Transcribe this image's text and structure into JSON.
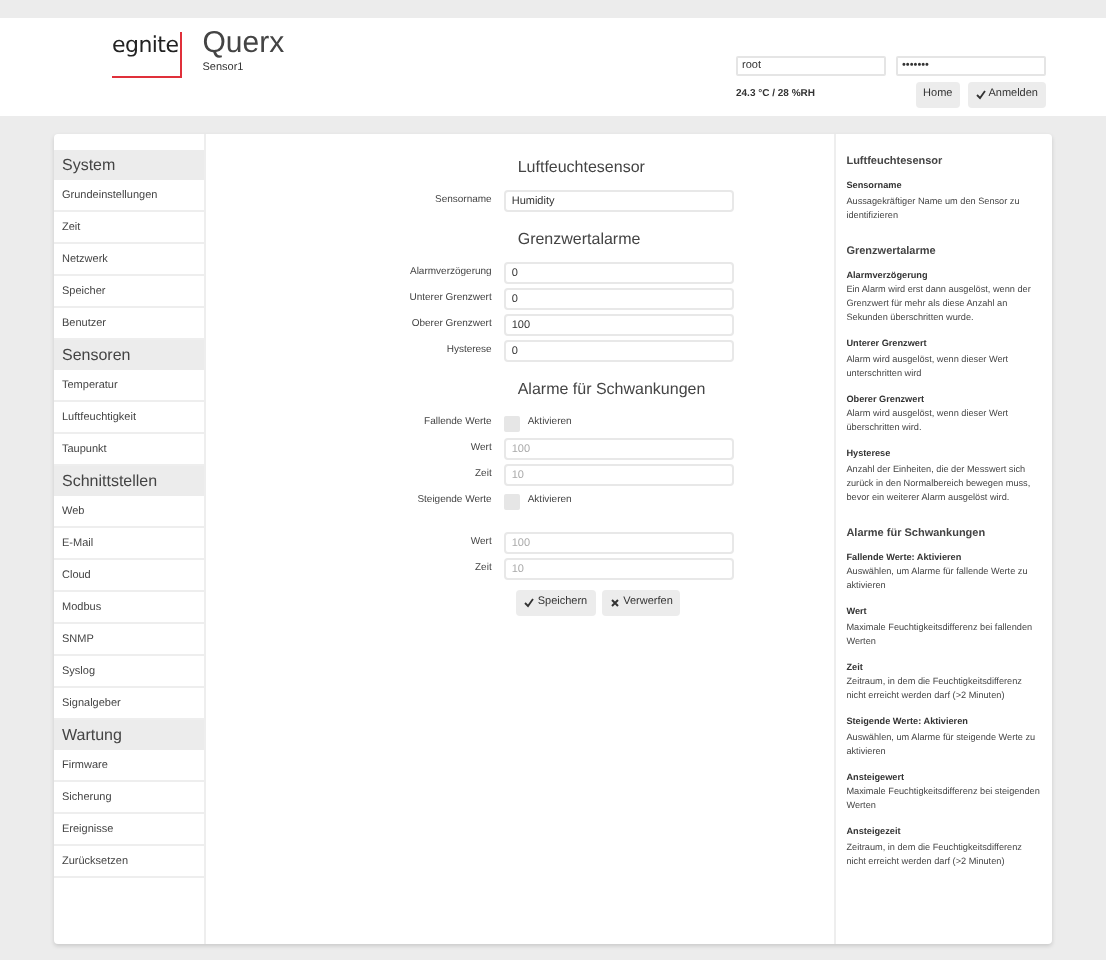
{
  "header": {
    "logo": "egnite",
    "title": "Querx",
    "subtitle": "Sensor1",
    "username": "root",
    "password": "•••••••",
    "status": "24.3 °C / 28 %RH",
    "buttons": [
      {
        "label": "Home",
        "kind": "plain"
      },
      {
        "label": "Anmelden",
        "kind": "confirm"
      }
    ]
  },
  "sidebar": [
    {
      "title": "System",
      "items": [
        "Grundeinstellungen",
        "Zeit",
        "Netzwerk",
        "Speicher",
        "Benutzer"
      ]
    },
    {
      "title": "Sensoren",
      "items": [
        "Temperatur",
        "Luftfeuchtigkeit",
        "Taupunkt"
      ]
    },
    {
      "title": "Schnittstellen",
      "items": [
        "Web",
        "E-Mail",
        "Cloud",
        "Modbus",
        "SNMP",
        "Syslog",
        "Signalgeber"
      ]
    },
    {
      "title": "Wartung",
      "items": [
        "Firmware",
        "Sicherung",
        "Ereignisse",
        "Zurücksetzen"
      ]
    }
  ],
  "form": {
    "sections": [
      {
        "title": "Luftfeuchtesensor",
        "fields": [
          {
            "kind": "text",
            "label": "Sensorname",
            "value": "Humidity"
          }
        ]
      },
      {
        "title": "Grenzwertalarme",
        "fields": [
          {
            "kind": "text",
            "label": "Alarmverzögerung",
            "value": "0"
          },
          {
            "kind": "text",
            "label": "Unterer Grenzwert",
            "value": "0"
          },
          {
            "kind": "text",
            "label": "Oberer Grenzwert",
            "value": "100"
          },
          {
            "kind": "text",
            "label": "Hysterese",
            "value": "0"
          }
        ]
      },
      {
        "title": "Alarme für Schwankungen",
        "fields": [
          {
            "kind": "checkbox",
            "label": "Fallende Werte",
            "option": "Aktivieren",
            "checked": false
          },
          {
            "kind": "text",
            "label": "Wert",
            "placeholder": "100"
          },
          {
            "kind": "text",
            "label": "Zeit",
            "placeholder": "10"
          },
          {
            "kind": "checkbox",
            "label": "Steigende Werte",
            "option": "Aktivieren",
            "checked": false
          },
          {
            "kind": "spacer"
          },
          {
            "kind": "text",
            "label": "Wert",
            "placeholder": "100"
          },
          {
            "kind": "text",
            "label": "Zeit",
            "placeholder": "10"
          }
        ]
      }
    ],
    "buttons": [
      {
        "label": "Speichern",
        "kind": "confirm"
      },
      {
        "label": "Verwerfen",
        "kind": "discard"
      }
    ]
  },
  "help": [
    {
      "title": "Luftfeuchtesensor",
      "entries": [
        {
          "term": "Sensorname",
          "text": "Aussagekräftiger Name um den Sensor zu identifizieren"
        }
      ]
    },
    {
      "title": "Grenzwertalarme",
      "entries": [
        {
          "term": "Alarmverzögerung",
          "text": "Ein Alarm wird erst dann ausgelöst, wenn der Grenzwert für mehr als diese Anzahl an Sekunden überschritten wurde."
        },
        {
          "term": "Unterer Grenzwert",
          "text": "Alarm wird ausgelöst, wenn dieser Wert unterschritten wird"
        },
        {
          "term": "Oberer Grenzwert",
          "text": "Alarm wird ausgelöst, wenn dieser Wert überschritten wird."
        },
        {
          "term": "Hysterese",
          "text": "Anzahl der Einheiten, die der Messwert sich zurück in den Normalbereich bewegen muss, bevor ein weiterer Alarm ausgelöst wird."
        }
      ]
    },
    {
      "title": "Alarme für Schwankungen",
      "entries": [
        {
          "term": "Fallende Werte: Aktivieren",
          "text": "Auswählen, um Alarme für fallende Werte zu aktivieren"
        },
        {
          "term": "Wert",
          "text": "Maximale Feuchtigkeitsdifferenz bei fallenden Werten"
        },
        {
          "term": "Zeit",
          "text": "Zeitraum, in dem die Feuchtigkeitsdifferenz nicht erreicht werden darf (>2 Minuten)"
        },
        {
          "term": "Steigende Werte: Aktivieren",
          "text": "Auswählen, um Alarme für steigende Werte zu aktivieren"
        },
        {
          "term": "Ansteigewert",
          "text": "Maximale Feuchtigkeitsdifferenz bei steigenden Werten"
        },
        {
          "term": "Ansteigezeit",
          "text": "Zeitraum, in dem die Feuchtigkeitsdifferenz nicht erreicht werden darf (>2 Minuten)"
        }
      ]
    }
  ]
}
